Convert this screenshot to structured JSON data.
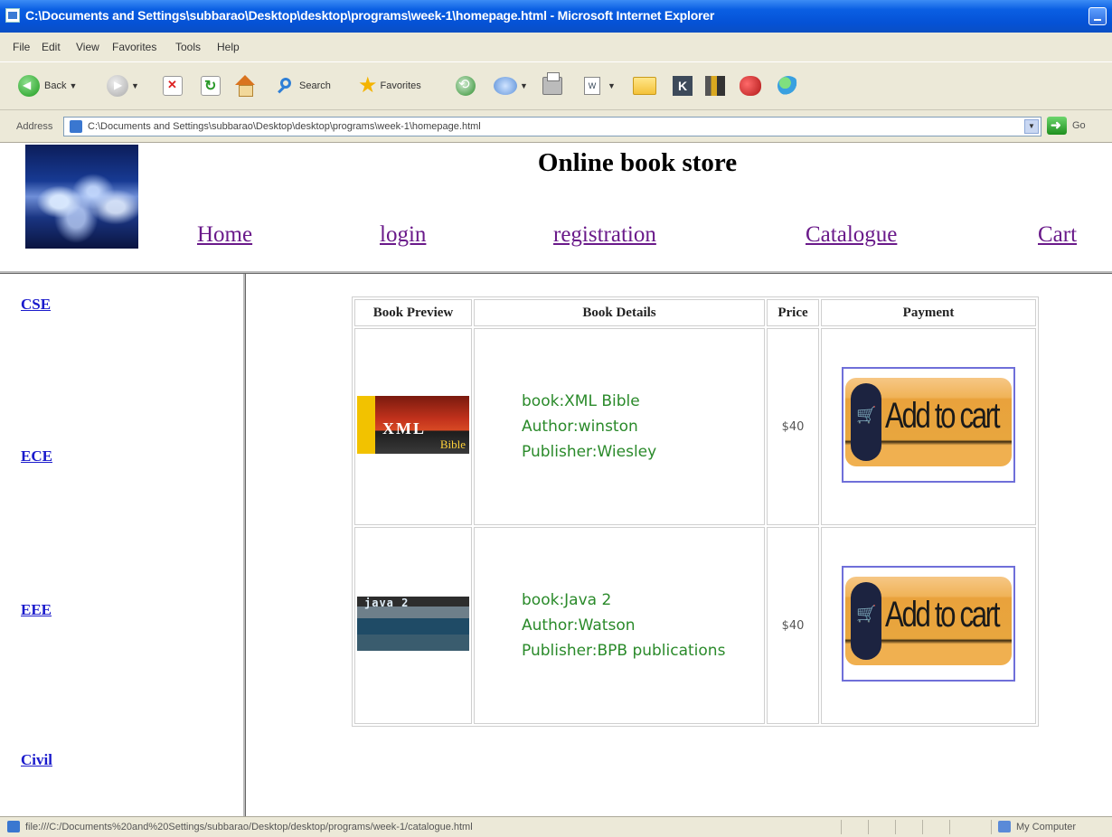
{
  "window": {
    "title": "C:\\Documents and Settings\\subbarao\\Desktop\\desktop\\programs\\week-1\\homepage.html - Microsoft Internet Explorer"
  },
  "menu": [
    "File",
    "Edit",
    "View",
    "Favorites",
    "Tools",
    "Help"
  ],
  "toolbar": {
    "back_label": "Back",
    "search_label": "Search",
    "favorites_label": "Favorites",
    "edit_icon_text": "W"
  },
  "address": {
    "label": "Address",
    "url": "C:\\Documents and Settings\\subbarao\\Desktop\\desktop\\programs\\week-1\\homepage.html",
    "go_label": "Go"
  },
  "site": {
    "title": "Online book store",
    "nav": [
      "Home",
      "login",
      "registration",
      "Catalogue",
      "Cart"
    ]
  },
  "sidebar": {
    "links": [
      "CSE",
      "ECE",
      "EEE",
      "Civil"
    ]
  },
  "table": {
    "headers": [
      "Book Preview",
      "Book Details",
      "Price",
      "Payment"
    ],
    "rows": [
      {
        "cover_text": "XML",
        "cover_subtext": "Bible",
        "details": [
          "book:XML Bible",
          "Author:winston",
          "Publisher:Wiesley"
        ],
        "price": "$40",
        "button_label": "Add to cart"
      },
      {
        "cover_text": "java 2",
        "details": [
          "book:Java 2",
          "Author:Watson",
          "Publisher:BPB publications"
        ],
        "price": "$40",
        "button_label": "Add to cart"
      }
    ]
  },
  "statusbar": {
    "text": "file:///C:/Documents%20and%20Settings/subbarao/Desktop/desktop/programs/week-1/catalogue.html",
    "zone": "My Computer"
  }
}
